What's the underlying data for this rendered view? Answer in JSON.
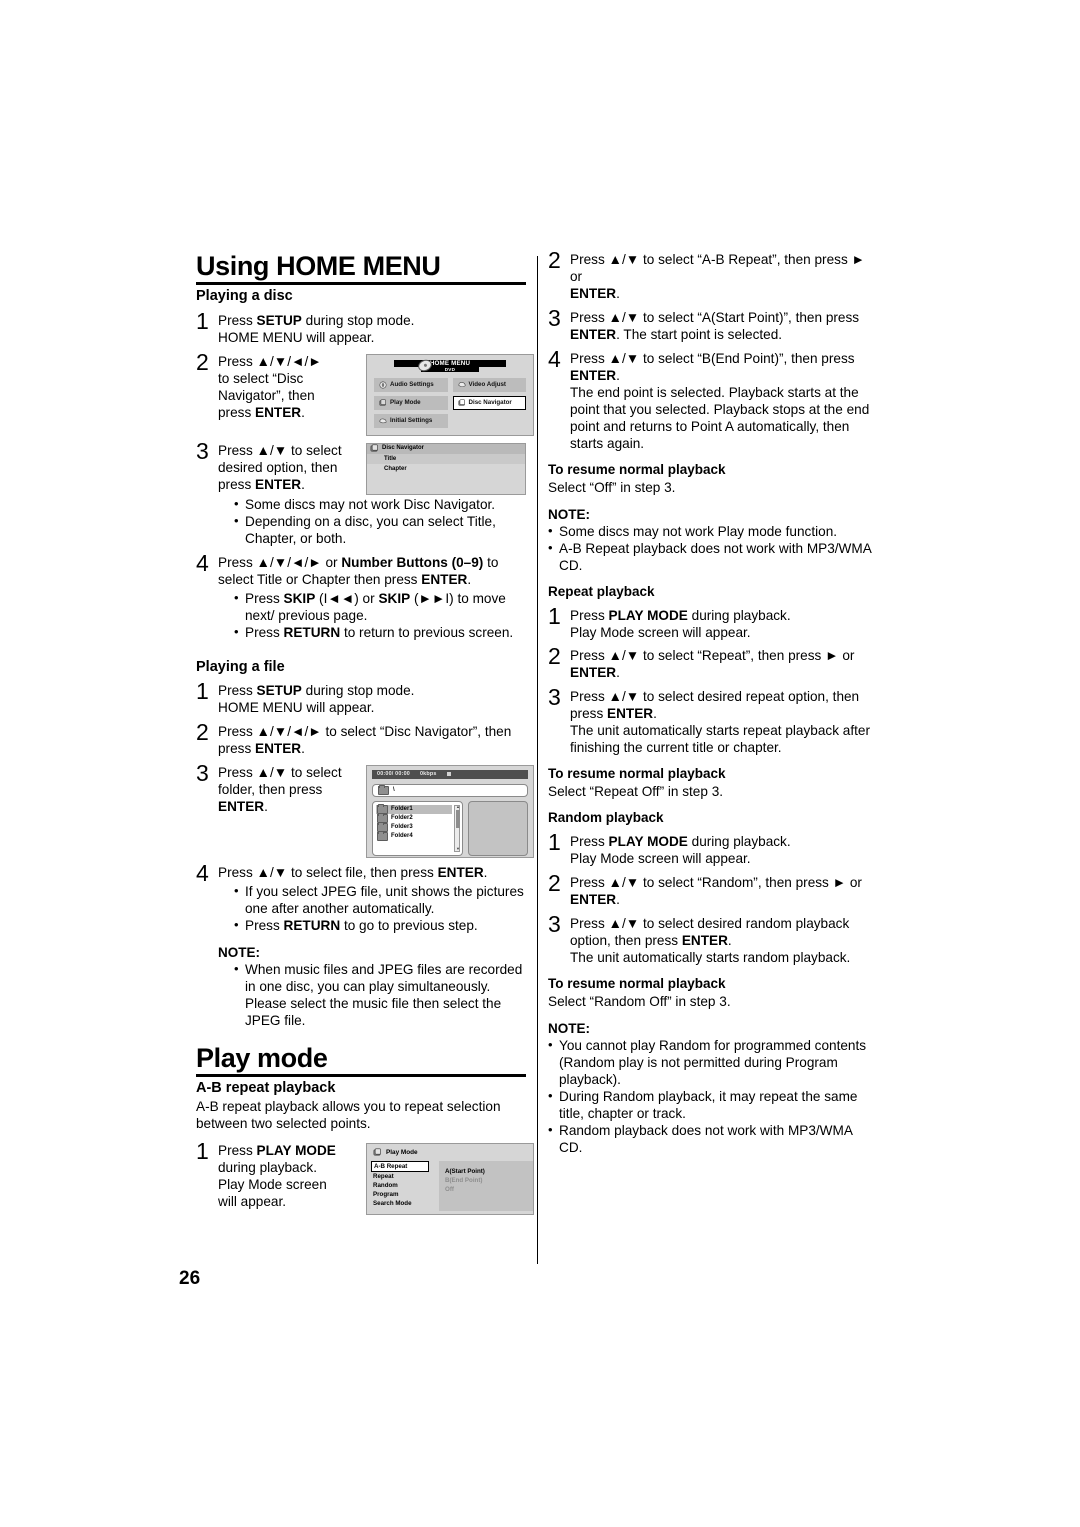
{
  "page": {
    "number": "26"
  },
  "left_column": {
    "title": "Using HOME MENU",
    "section_playing_disc": {
      "heading": "Playing a disc",
      "steps": [
        {
          "num": "1",
          "text": "Press SETUP during stop mode. HOME MENU will appear.",
          "line1_a": "Press ",
          "line1_b": "SETUP",
          "line1_c": " during stop mode.",
          "line2": "HOME MENU will appear."
        },
        {
          "num": "2",
          "line1": "Press ▲/▼/◄/►",
          "line2": "to select “Disc",
          "line3": "Navigator”, then",
          "line4_a": "press ",
          "line4_b": "ENTER",
          "line4_c": "."
        },
        {
          "num": "3",
          "line1": "Press ▲/▼ to select",
          "line2": "desired option, then",
          "line3_a": "press ",
          "line3_b": "ENTER",
          "line3_c": ".",
          "bullets": [
            "Some discs may not work Disc Navigator.",
            "Depending on a disc, you can select Title, Chapter, or both."
          ]
        },
        {
          "num": "4",
          "line1_a": "Press ▲/▼/◄/► or ",
          "line1_b": "Number Buttons (0–9)",
          "line1_c": " to",
          "line2_a": "select Title or Chapter then press ",
          "line2_b": "ENTER",
          "line2_c": ".",
          "bullets": [
            {
              "a": "Press ",
              "b": "SKIP",
              "c": " (I◄◄) or ",
              "d": "SKIP",
              "e": " (►►I) to move next/ previous page."
            },
            {
              "a": "Press ",
              "b": "RETURN",
              "c": " to return to previous screen."
            }
          ]
        }
      ]
    },
    "section_playing_file": {
      "heading": "Playing a file",
      "steps": [
        {
          "num": "1",
          "line1_a": "Press ",
          "line1_b": "SETUP",
          "line1_c": " during stop mode.",
          "line2": "HOME MENU will appear."
        },
        {
          "num": "2",
          "line1": "Press ▲/▼/◄/► to select “Disc Navigator”, then",
          "line2_a": "press ",
          "line2_b": "ENTER",
          "line2_c": "."
        },
        {
          "num": "3",
          "line1": "Press ▲/▼ to select",
          "line2": "folder, then press",
          "line3_a": "ENTER",
          "line3_b": "."
        },
        {
          "num": "4",
          "line1_a": "Press ▲/▼ to select file, then press ",
          "line1_b": "ENTER",
          "line1_c": ".",
          "bullets": [
            {
              "a": "If you select JPEG file, unit shows the pictures one after another automatically."
            },
            {
              "a": "Press ",
              "b": "RETURN",
              "c": " to go to previous step."
            }
          ]
        }
      ],
      "note_label": "NOTE:",
      "note_bullets": [
        "When music files and JPEG files are recorded in one disc, you can play simultaneously. Please select the music file then select the JPEG file."
      ]
    },
    "section_play_mode": {
      "title": "Play mode",
      "heading": "A-B repeat playback",
      "intro": "A-B repeat playback allows you to repeat selection between two selected points.",
      "step": {
        "num": "1",
        "line1_a": "Press ",
        "line1_b": "PLAY MODE",
        "line2": "during playback.",
        "line3": "Play Mode screen",
        "line4": "will appear."
      }
    }
  },
  "right_column": {
    "steps_ab": [
      {
        "num": "2",
        "line1": "Press ▲/▼ to select “A-B Repeat”, then press ► or",
        "line2_a": "ENTER",
        "line2_b": "."
      },
      {
        "num": "3",
        "line1": "Press ▲/▼ to select “A(Start Point)”, then press",
        "line2_a": "ENTER",
        "line2_b": ". The start point is selected."
      },
      {
        "num": "4",
        "line1": "Press ▲/▼ to select “B(End Point)”, then press",
        "line2_a": "ENTER",
        "line2_b": ".",
        "line3": "The end point is selected. Playback starts at the point that you selected. Playback stops at the end point and returns to Point A automatically, then starts again."
      }
    ],
    "resume_1": {
      "heading": "To resume normal playback",
      "text": "Select “Off” in step 3."
    },
    "note_1": {
      "label": "NOTE:",
      "bullets": [
        "Some discs may not work Play mode function.",
        "A-B Repeat playback does not work with MP3/WMA CD."
      ]
    },
    "repeat_playback": {
      "heading": "Repeat playback",
      "steps": [
        {
          "num": "1",
          "line1_a": "Press ",
          "line1_b": "PLAY MODE",
          "line1_c": " during playback.",
          "line2": "Play Mode screen will appear."
        },
        {
          "num": "2",
          "line1": "Press ▲/▼ to select “Repeat”, then press ► or",
          "line2_a": "ENTER",
          "line2_b": "."
        },
        {
          "num": "3",
          "line1": "Press ▲/▼ to select desired repeat option, then",
          "line2_a": "press ",
          "line2_b": "ENTER",
          "line2_c": ".",
          "line3": "The unit automatically starts repeat playback after finishing the current title or chapter."
        }
      ]
    },
    "resume_2": {
      "heading": "To resume normal playback",
      "text": "Select “Repeat Off” in step 3."
    },
    "random_playback": {
      "heading": "Random playback",
      "steps": [
        {
          "num": "1",
          "line1_a": "Press ",
          "line1_b": "PLAY MODE",
          "line1_c": " during playback.",
          "line2": "Play Mode screen will appear."
        },
        {
          "num": "2",
          "line1": "Press ▲/▼ to select “Random”, then press ► or",
          "line2_a": "ENTER",
          "line2_b": "."
        },
        {
          "num": "3",
          "line1": "Press ▲/▼ to select desired random playback",
          "line2_a": "option, then press ",
          "line2_b": "ENTER",
          "line2_c": ".",
          "line3": "The unit automatically starts random playback."
        }
      ]
    },
    "resume_3": {
      "heading": "To resume normal playback",
      "text": "Select “Random Off” in step 3."
    },
    "note_2": {
      "label": "NOTE:",
      "bullets": [
        "You cannot play Random for programmed contents (Random play is not permitted during Program playback).",
        "During Random playback, it may repeat the same title, chapter or track.",
        "Random playback does not work with MP3/WMA CD."
      ]
    }
  },
  "figures": {
    "home_menu": {
      "title": "HOME MENU",
      "subtitle": "DVD",
      "items": [
        {
          "label": "Audio Settings",
          "icon": "speaker-icon",
          "selected": false
        },
        {
          "label": "Video Adjust",
          "icon": "monitor-icon",
          "selected": false
        },
        {
          "label": "Play Mode",
          "icon": "play-mode-icon",
          "selected": false
        },
        {
          "label": "Disc Navigator",
          "icon": "disc-navigator-icon",
          "selected": true
        },
        {
          "label": "Initial Settings",
          "icon": "initial-settings-icon",
          "selected": false
        }
      ]
    },
    "disc_navigator": {
      "title": "Disc Navigator",
      "rows": [
        {
          "label": "Title",
          "selected": true
        },
        {
          "label": "Chapter",
          "selected": false
        }
      ]
    },
    "file_browser": {
      "time": "00:00/ 00:00",
      "bitrate": "0kbps",
      "path": "\\",
      "items": [
        {
          "label": "Folder1",
          "selected": true
        },
        {
          "label": "Folder2",
          "selected": false
        },
        {
          "label": "Folder3",
          "selected": false
        },
        {
          "label": "Folder4",
          "selected": false
        }
      ]
    },
    "play_mode": {
      "title": "Play Mode",
      "options": [
        {
          "label": "A-B Repeat",
          "selected": true
        },
        {
          "label": "Repeat",
          "selected": false
        },
        {
          "label": "Random",
          "selected": false
        },
        {
          "label": "Program",
          "selected": false
        },
        {
          "label": "Search Mode",
          "selected": false
        }
      ],
      "values": [
        {
          "label": "A(Start Point)",
          "dim": false
        },
        {
          "label": "B(End Point)",
          "dim": true
        },
        {
          "label": "Off",
          "dim": true
        }
      ]
    }
  }
}
